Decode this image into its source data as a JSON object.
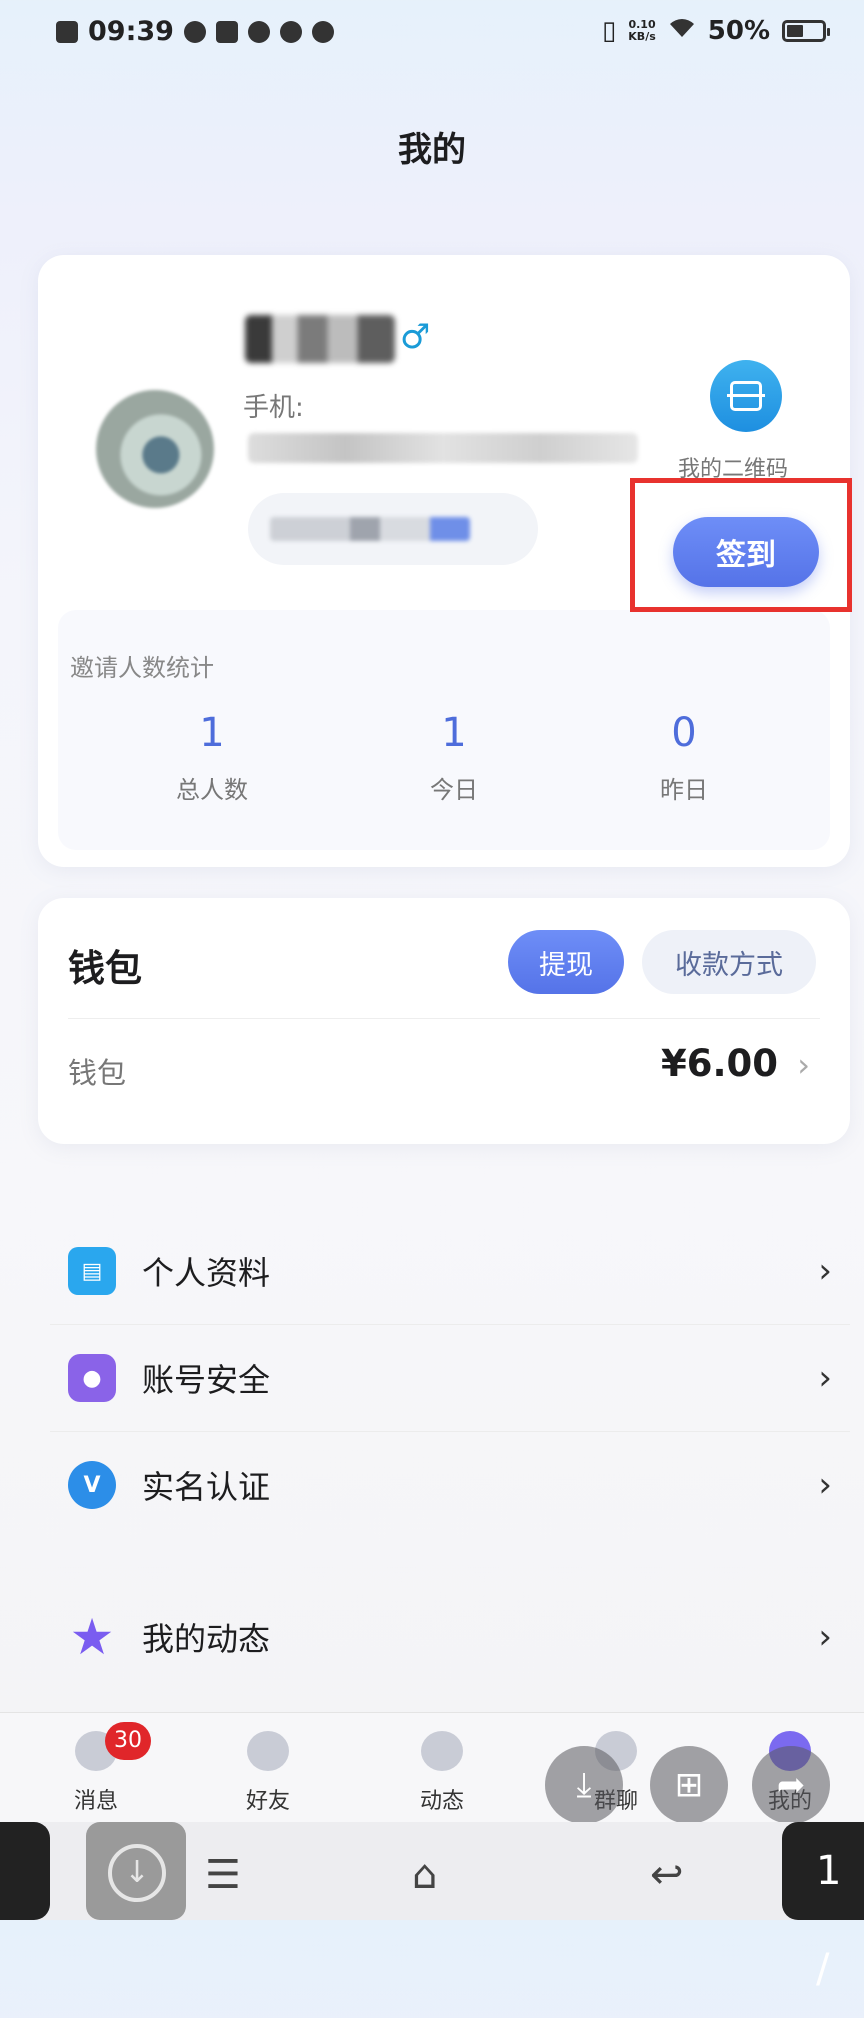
{
  "status_bar": {
    "time": "09:39",
    "speed_top": "0.10",
    "speed_bottom": "KB/s",
    "battery": "50%"
  },
  "page": {
    "title": "我的"
  },
  "profile": {
    "phone_label": "手机:",
    "qr_label": "我的二维码",
    "checkin_label": "签到"
  },
  "invite_stats": {
    "title": "邀请人数统计",
    "items": [
      {
        "value": "1",
        "label": "总人数"
      },
      {
        "value": "1",
        "label": "今日"
      },
      {
        "value": "0",
        "label": "昨日"
      }
    ]
  },
  "wallet": {
    "title": "钱包",
    "withdraw_label": "提现",
    "method_label": "收款方式",
    "row_label": "钱包",
    "amount": "¥6.00"
  },
  "menu": {
    "items": [
      {
        "label": "个人资料",
        "icon": "id-card-icon"
      },
      {
        "label": "账号安全",
        "icon": "lock-icon"
      },
      {
        "label": "实名认证",
        "icon": "verified-icon"
      },
      {
        "label": "我的动态",
        "icon": "star-icon"
      }
    ]
  },
  "tabbar": {
    "badge": "30",
    "items": [
      {
        "label": "消息"
      },
      {
        "label": "好友"
      },
      {
        "label": "动态"
      },
      {
        "label": "群聊"
      },
      {
        "label": "我的"
      }
    ]
  },
  "system_nav": {
    "page_indicator": "1 /"
  },
  "colors": {
    "accent": "#5573e8",
    "highlight_box": "#e8322e",
    "badge": "#e0262a"
  }
}
